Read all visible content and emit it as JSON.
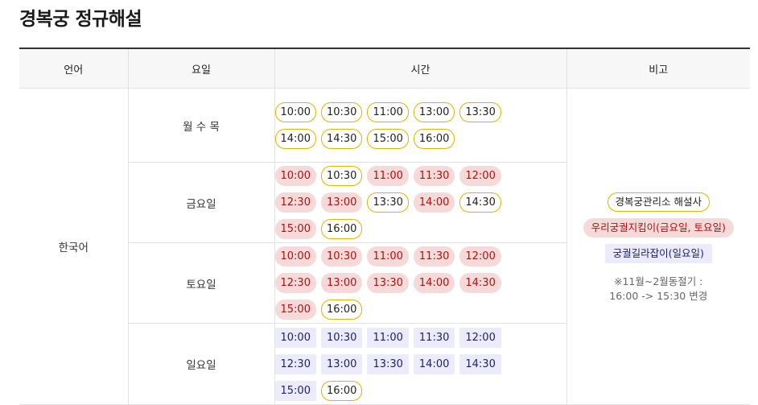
{
  "page": {
    "title": "경복궁 정규해설"
  },
  "table": {
    "headers": [
      "언어",
      "요일",
      "시간",
      "비고"
    ],
    "language": "한국어",
    "rows": [
      {
        "day": "월 수 목",
        "slots": [
          {
            "time": "10:00",
            "type": "yellow"
          },
          {
            "time": "10:30",
            "type": "yellow"
          },
          {
            "time": "11:00",
            "type": "yellow"
          },
          {
            "time": "13:00",
            "type": "yellow"
          },
          {
            "time": "13:30",
            "type": "yellow"
          },
          {
            "time": "14:00",
            "type": "yellow"
          },
          {
            "time": "14:30",
            "type": "yellow"
          },
          {
            "time": "15:00",
            "type": "yellow"
          },
          {
            "time": "16:00",
            "type": "yellow"
          }
        ]
      },
      {
        "day": "금요일",
        "slots": [
          {
            "time": "10:00",
            "type": "red"
          },
          {
            "time": "10:30",
            "type": "yellow"
          },
          {
            "time": "11:00",
            "type": "red"
          },
          {
            "time": "11:30",
            "type": "red"
          },
          {
            "time": "12:00",
            "type": "red"
          },
          {
            "time": "12:30",
            "type": "red"
          },
          {
            "time": "13:00",
            "type": "red"
          },
          {
            "time": "13:30",
            "type": "yellow"
          },
          {
            "time": "14:00",
            "type": "red"
          },
          {
            "time": "14:30",
            "type": "yellow"
          },
          {
            "time": "15:00",
            "type": "red"
          },
          {
            "time": "16:00",
            "type": "yellow"
          }
        ]
      },
      {
        "day": "토요일",
        "slots": [
          {
            "time": "10:00",
            "type": "red"
          },
          {
            "time": "10:30",
            "type": "red"
          },
          {
            "time": "11:00",
            "type": "red"
          },
          {
            "time": "11:30",
            "type": "red"
          },
          {
            "time": "12:00",
            "type": "red"
          },
          {
            "time": "12:30",
            "type": "red"
          },
          {
            "time": "13:00",
            "type": "red"
          },
          {
            "time": "13:30",
            "type": "red"
          },
          {
            "time": "14:00",
            "type": "red"
          },
          {
            "time": "14:30",
            "type": "red"
          },
          {
            "time": "15:00",
            "type": "red"
          },
          {
            "time": "16:00",
            "type": "yellow"
          }
        ]
      },
      {
        "day": "일요일",
        "slots": [
          {
            "time": "10:00",
            "type": "purple"
          },
          {
            "time": "10:30",
            "type": "purple"
          },
          {
            "time": "11:00",
            "type": "purple"
          },
          {
            "time": "11:30",
            "type": "purple"
          },
          {
            "time": "12:00",
            "type": "purple"
          },
          {
            "time": "12:30",
            "type": "purple"
          },
          {
            "time": "13:00",
            "type": "purple"
          },
          {
            "time": "13:30",
            "type": "purple"
          },
          {
            "time": "14:00",
            "type": "purple"
          },
          {
            "time": "14:30",
            "type": "purple"
          },
          {
            "time": "15:00",
            "type": "purple"
          },
          {
            "time": "16:00",
            "type": "yellow"
          }
        ]
      }
    ],
    "notes": {
      "legend_yellow": "경복궁관리소 해설사",
      "legend_red": "우리궁궐지킴이(금요일, 토요일)",
      "legend_purple": "궁궐길라잡이(일요일)",
      "note_line1": "※11월~2월동절기 :",
      "note_line2": "16:00 -> 15:30 변경"
    }
  },
  "colors": {
    "yellow_border": "#e0b400",
    "red_bg": "#f6dada",
    "red_text": "#b01010",
    "purple_bg": "#ecebfb",
    "purple_text": "#1e1e6e"
  }
}
